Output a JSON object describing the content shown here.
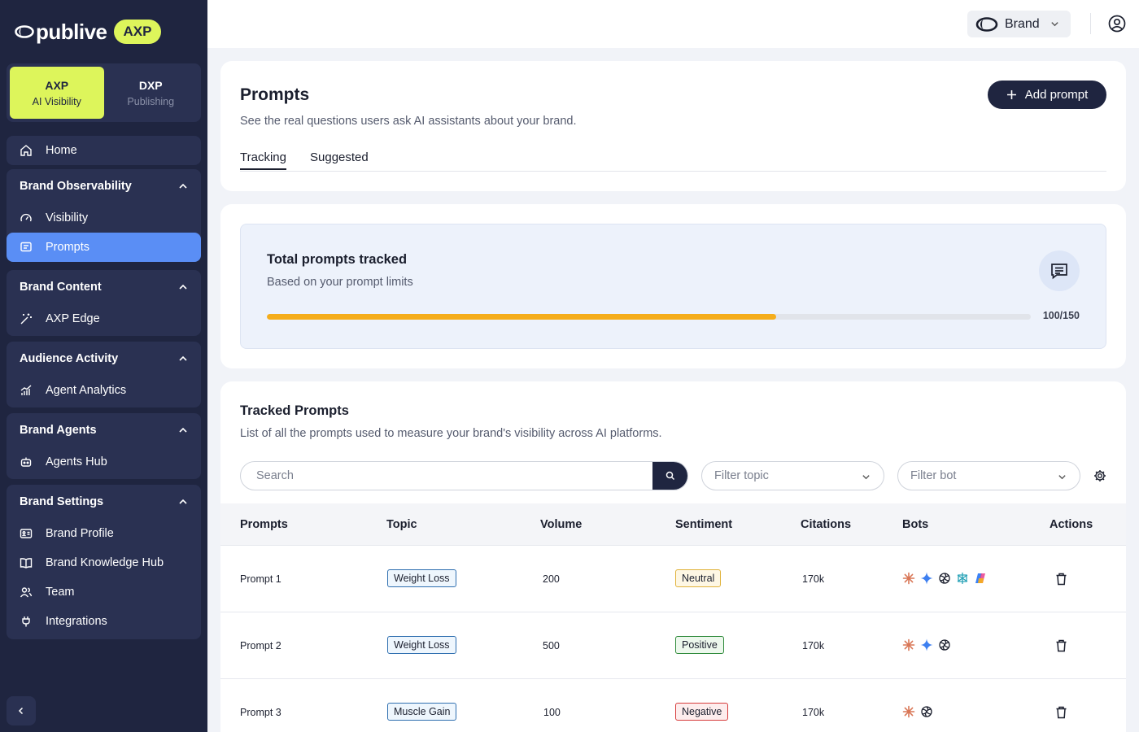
{
  "logo": {
    "name": "publive",
    "badge": "AXP"
  },
  "switcher": [
    {
      "title": "AXP",
      "subtitle": "AI Visibility",
      "active": true
    },
    {
      "title": "DXP",
      "subtitle": "Publishing",
      "active": false
    }
  ],
  "nav": {
    "home": "Home",
    "groups": [
      {
        "title": "Brand Observability",
        "items": [
          "Visibility",
          "Prompts"
        ]
      },
      {
        "title": "Brand Content",
        "items": [
          "AXP Edge"
        ]
      },
      {
        "title": "Audience Activity",
        "items": [
          "Agent Analytics"
        ]
      },
      {
        "title": "Brand Agents",
        "items": [
          "Agents Hub"
        ]
      },
      {
        "title": "Brand Settings",
        "items": [
          "Brand Profile",
          "Brand Knowledge Hub",
          "Team",
          "Integrations"
        ]
      }
    ],
    "active_item": "Prompts"
  },
  "topbar": {
    "brand_label": "Brand"
  },
  "header": {
    "title": "Prompts",
    "subtitle": "See the real questions users ask AI assistants about your brand.",
    "add_button": "Add prompt",
    "tabs": [
      "Tracking",
      "Suggested"
    ],
    "active_tab": "Tracking"
  },
  "stat": {
    "title": "Total prompts tracked",
    "subtitle": "Based on your prompt limits",
    "value_text": "100/150",
    "progress": 0.667
  },
  "tracked": {
    "title": "Tracked Prompts",
    "subtitle": "List of all the prompts used to measure your brand's visibility across AI platforms.",
    "search_placeholder": "Search",
    "filter_topic_placeholder": "Filter topic",
    "filter_bot_placeholder": "Filter bot",
    "columns": [
      "Prompts",
      "Topic",
      "Volume",
      "Sentiment",
      "Citations",
      "Bots",
      "Actions"
    ],
    "rows": [
      {
        "prompt": "Prompt 1",
        "topic": "Weight Loss",
        "volume": "200",
        "sentiment": "Neutral",
        "citations": "170k",
        "bots": [
          "claude-icon",
          "gemini-icon",
          "chatgpt-icon",
          "perplexity-icon",
          "copilot-icon"
        ]
      },
      {
        "prompt": "Prompt 2",
        "topic": "Weight Loss",
        "volume": "500",
        "sentiment": "Positive",
        "citations": "170k",
        "bots": [
          "claude-icon",
          "gemini-icon",
          "chatgpt-icon"
        ]
      },
      {
        "prompt": "Prompt 3",
        "topic": "Muscle Gain",
        "volume": "100",
        "sentiment": "Negative",
        "citations": "170k",
        "bots": [
          "claude-icon",
          "chatgpt-icon"
        ]
      }
    ]
  },
  "colors": {
    "sidebar": "#1f2540",
    "accent": "#ddf55b",
    "active_nav": "#5a8ef5",
    "progress": "#f5ad1b"
  }
}
